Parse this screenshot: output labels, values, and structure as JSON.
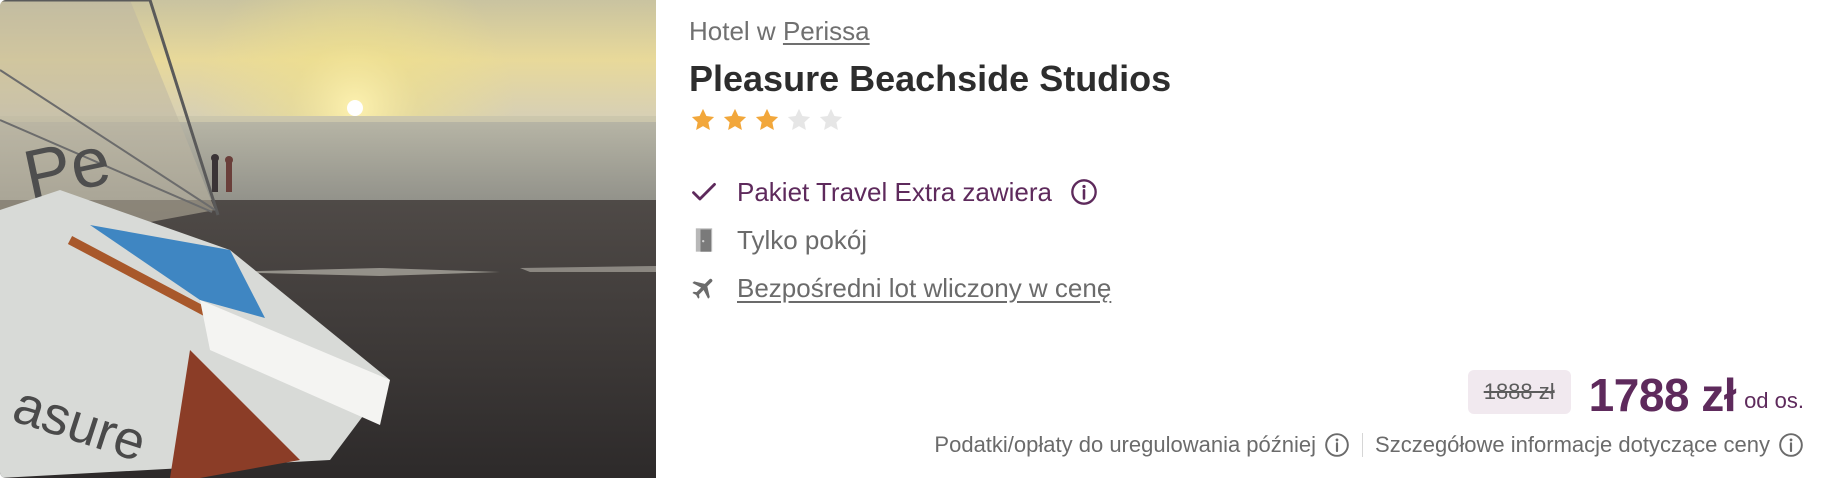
{
  "hotel": {
    "location_prefix": "Hotel w",
    "location_link": "Perissa",
    "name": "Pleasure Beachside Studios",
    "rating": 3,
    "max_rating": 5
  },
  "features": {
    "package_extra": "Pakiet Travel Extra zawiera",
    "room_only": "Tylko pokój",
    "direct_flight": "Bezpośredni lot wliczony w cenę"
  },
  "price": {
    "old": "1888 zł",
    "current": "1788 zł",
    "per_person": "od os."
  },
  "footer": {
    "taxes_note": "Podatki/opłaty do uregulowania później",
    "price_details": "Szczegółowe informacje dotyczące ceny"
  },
  "colors": {
    "accent": "#5e2a5c",
    "star_filled": "#f2a73b",
    "star_empty": "#e6e6e6",
    "old_price_bg": "#f1e9ef"
  },
  "icons": {
    "check": "check-icon",
    "room": "door-icon",
    "flight": "airplane-icon",
    "info": "info-icon"
  }
}
